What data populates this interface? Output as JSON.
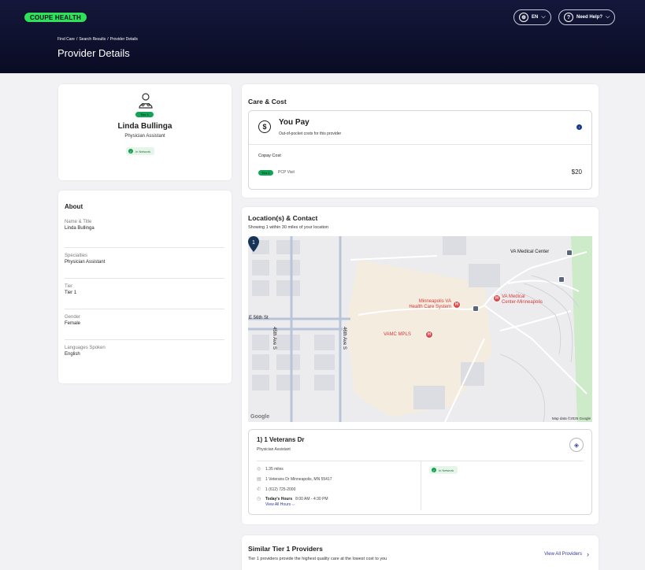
{
  "header": {
    "logo": "COUPE HEALTH",
    "lang": "EN",
    "help": "Need Help?",
    "breadcrumb": [
      "Find Care",
      "Search Results",
      "Provider Details"
    ],
    "title": "Provider Details"
  },
  "profile": {
    "tier": "Tier 1",
    "name": "Linda Bullinga",
    "role": "Physician Assistant",
    "network": "In Network"
  },
  "about": {
    "heading": "About",
    "rows": [
      {
        "label": "Name & Title",
        "value": "Linda Bullinga"
      },
      {
        "label": "Specialties",
        "value": "Physician Assistant"
      },
      {
        "label": "Tier",
        "value": "Tier 1"
      },
      {
        "label": "Gender",
        "value": "Female"
      },
      {
        "label": "Languages Spoken",
        "value": "English"
      }
    ]
  },
  "care": {
    "heading": "Care & Cost",
    "you_pay": "You Pay",
    "you_pay_sub": "Out-of-pocket costs for this provider",
    "copay_label": "Copay Cost",
    "tier": "Tier 1",
    "service": "PCP Visit",
    "price": "$20"
  },
  "location": {
    "heading": "Location(s) & Contact",
    "subtitle": "Showing 1 within 30 miles of your location",
    "map": {
      "va_center": "VA Medical Center",
      "mpls_va": "Minneapolis VA",
      "mpls_va2": "Health Care System",
      "va_med": "VA Medical",
      "va_med2": "Center-Minneapolis",
      "vamc": "VAMC MPLS",
      "street": "E 56th St",
      "ave45": "45th Ave S",
      "ave46": "46th Ave S",
      "marker": "1",
      "attribution": "Map data ©2025 Google",
      "google": "Google"
    },
    "address": {
      "name": "1) 1 Veterans Dr",
      "role": "Physician Assistant",
      "distance": "1.35 miles",
      "street": "1 Veterans Dr Minneapolis, MN 55417",
      "phone": "1 (612) 725-2000",
      "hours_label": "Today's Hours",
      "hours": "8:00 AM - 4:30 PM",
      "view_hours": "View All Hours",
      "network": "In Network"
    }
  },
  "similar": {
    "heading": "Similar Tier 1 Providers",
    "subtitle": "Tier 1 providers provide the highest quality care at the lowest cost to you",
    "view_all": "View All Providers"
  }
}
